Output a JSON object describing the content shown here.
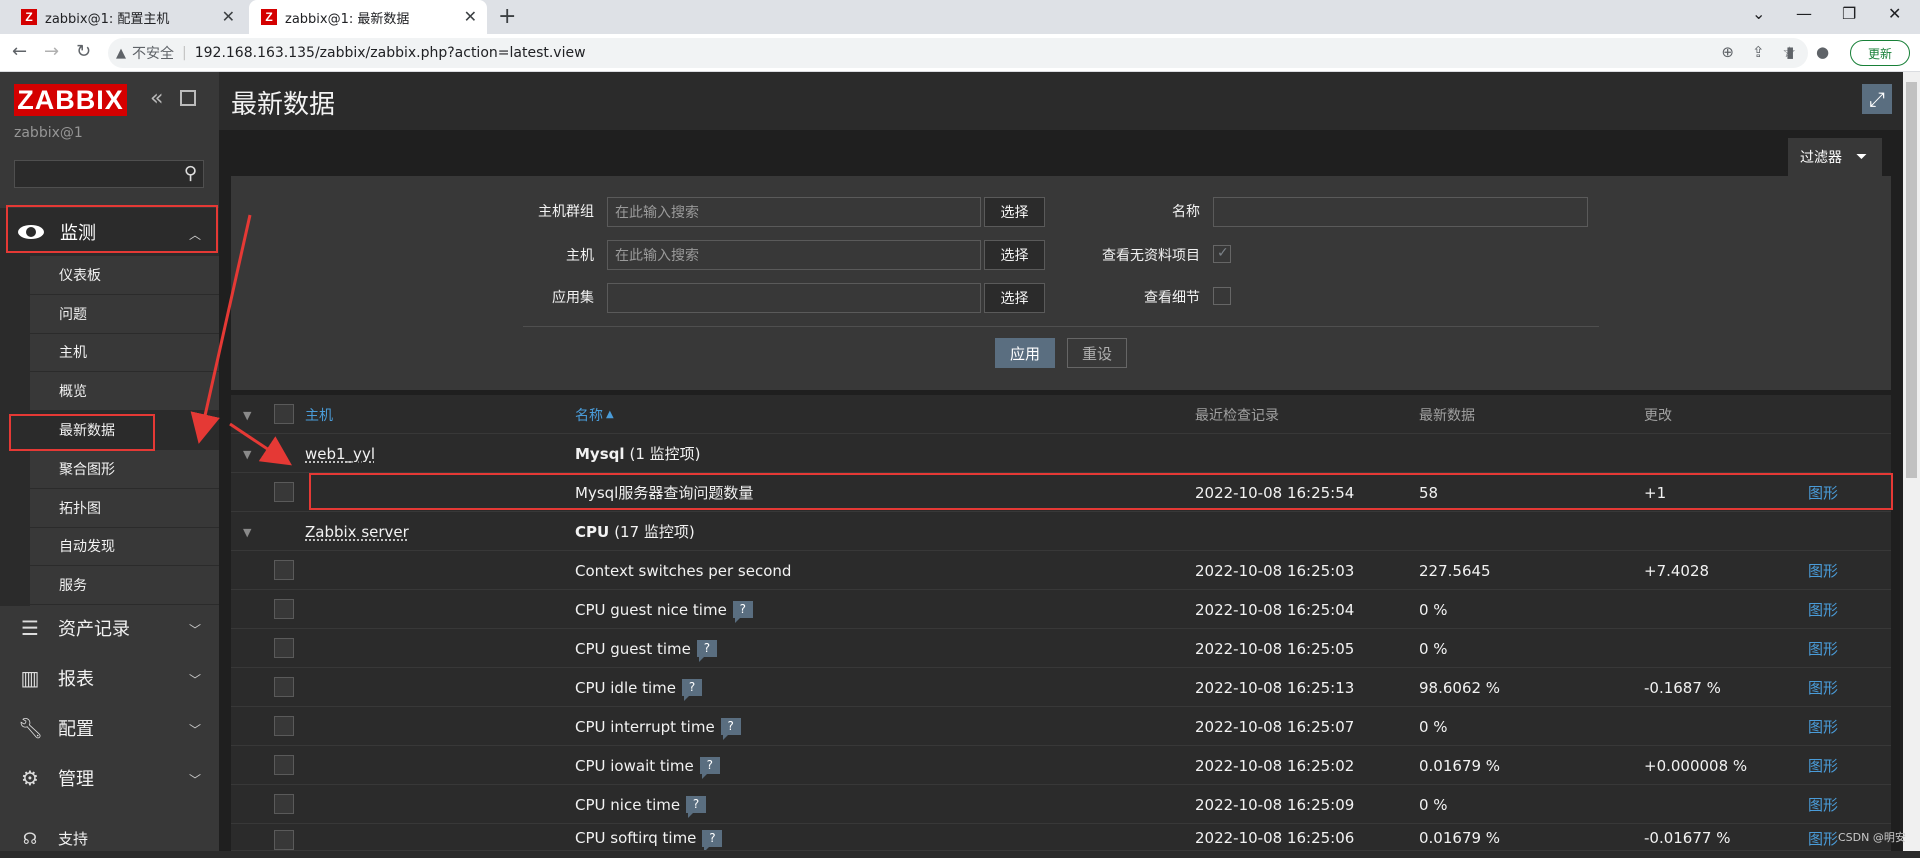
{
  "browser": {
    "tabs": [
      {
        "title": "zabbix@1: 配置主机",
        "active": false
      },
      {
        "title": "zabbix@1: 最新数据",
        "active": true
      }
    ],
    "security_label": "不安全",
    "url": "192.168.163.135/zabbix/zabbix.php?action=latest.view",
    "update_label": "更新"
  },
  "sidebar": {
    "logo": "ZABBIX",
    "user": "zabbix@1",
    "search": {
      "value": "",
      "placeholder": ""
    },
    "monitoring": {
      "label": "监测",
      "items": [
        "仪表板",
        "问题",
        "主机",
        "概览",
        "最新数据",
        "聚合图形",
        "拓扑图",
        "自动发现",
        "服务"
      ],
      "selected": "最新数据"
    },
    "menus": [
      "资产记录",
      "报表",
      "配置",
      "管理",
      "支持"
    ]
  },
  "page": {
    "title": "最新数据"
  },
  "filter": {
    "tab_label": "过滤器",
    "host_groups_label": "主机群组",
    "host_groups_placeholder": "在此输入搜索",
    "hosts_label": "主机",
    "hosts_placeholder": "在此输入搜索",
    "applications_label": "应用集",
    "applications_value": "",
    "select_label": "选择",
    "name_label": "名称",
    "name_value": "",
    "show_without_data_label": "查看无资料项目",
    "show_without_data_checked": true,
    "show_details_label": "查看细节",
    "show_details_checked": false,
    "apply_label": "应用",
    "reset_label": "重设"
  },
  "table": {
    "headers": {
      "host": "主机",
      "name": "名称",
      "last_check": "最近检查记录",
      "last_value": "最新数据",
      "change": "更改"
    },
    "sort_indicator": "▲",
    "groups": [
      {
        "host": "web1_yyl",
        "application": "Mysql",
        "count_label": "(1 监控项)",
        "items": [
          {
            "name": "Mysql服务器查询问题数量",
            "last_check": "2022-10-08 16:25:54",
            "last_value": "58",
            "change": "+1",
            "help": false,
            "graph": "图形"
          }
        ]
      },
      {
        "host": "Zabbix server",
        "application": "CPU",
        "count_label": "(17 监控项)",
        "items": [
          {
            "name": "Context switches per second",
            "last_check": "2022-10-08 16:25:03",
            "last_value": "227.5645",
            "change": "+7.4028",
            "help": false,
            "graph": "图形"
          },
          {
            "name": "CPU guest nice time",
            "last_check": "2022-10-08 16:25:04",
            "last_value": "0 %",
            "change": "",
            "help": true,
            "graph": "图形"
          },
          {
            "name": "CPU guest time",
            "last_check": "2022-10-08 16:25:05",
            "last_value": "0 %",
            "change": "",
            "help": true,
            "graph": "图形"
          },
          {
            "name": "CPU idle time",
            "last_check": "2022-10-08 16:25:13",
            "last_value": "98.6062 %",
            "change": "-0.1687 %",
            "help": true,
            "graph": "图形"
          },
          {
            "name": "CPU interrupt time",
            "last_check": "2022-10-08 16:25:07",
            "last_value": "0 %",
            "change": "",
            "help": true,
            "graph": "图形"
          },
          {
            "name": "CPU iowait time",
            "last_check": "2022-10-08 16:25:02",
            "last_value": "0.01679 %",
            "change": "+0.000008 %",
            "help": true,
            "graph": "图形"
          },
          {
            "name": "CPU nice time",
            "last_check": "2022-10-08 16:25:09",
            "last_value": "0 %",
            "change": "",
            "help": true,
            "graph": "图形"
          },
          {
            "name": "CPU softirq time",
            "last_check": "2022-10-08 16:25:06",
            "last_value": "0.01679 %",
            "change": "-0.01677 %",
            "help": true,
            "graph": "图形"
          }
        ]
      }
    ]
  },
  "watermark": "CSDN @明安"
}
